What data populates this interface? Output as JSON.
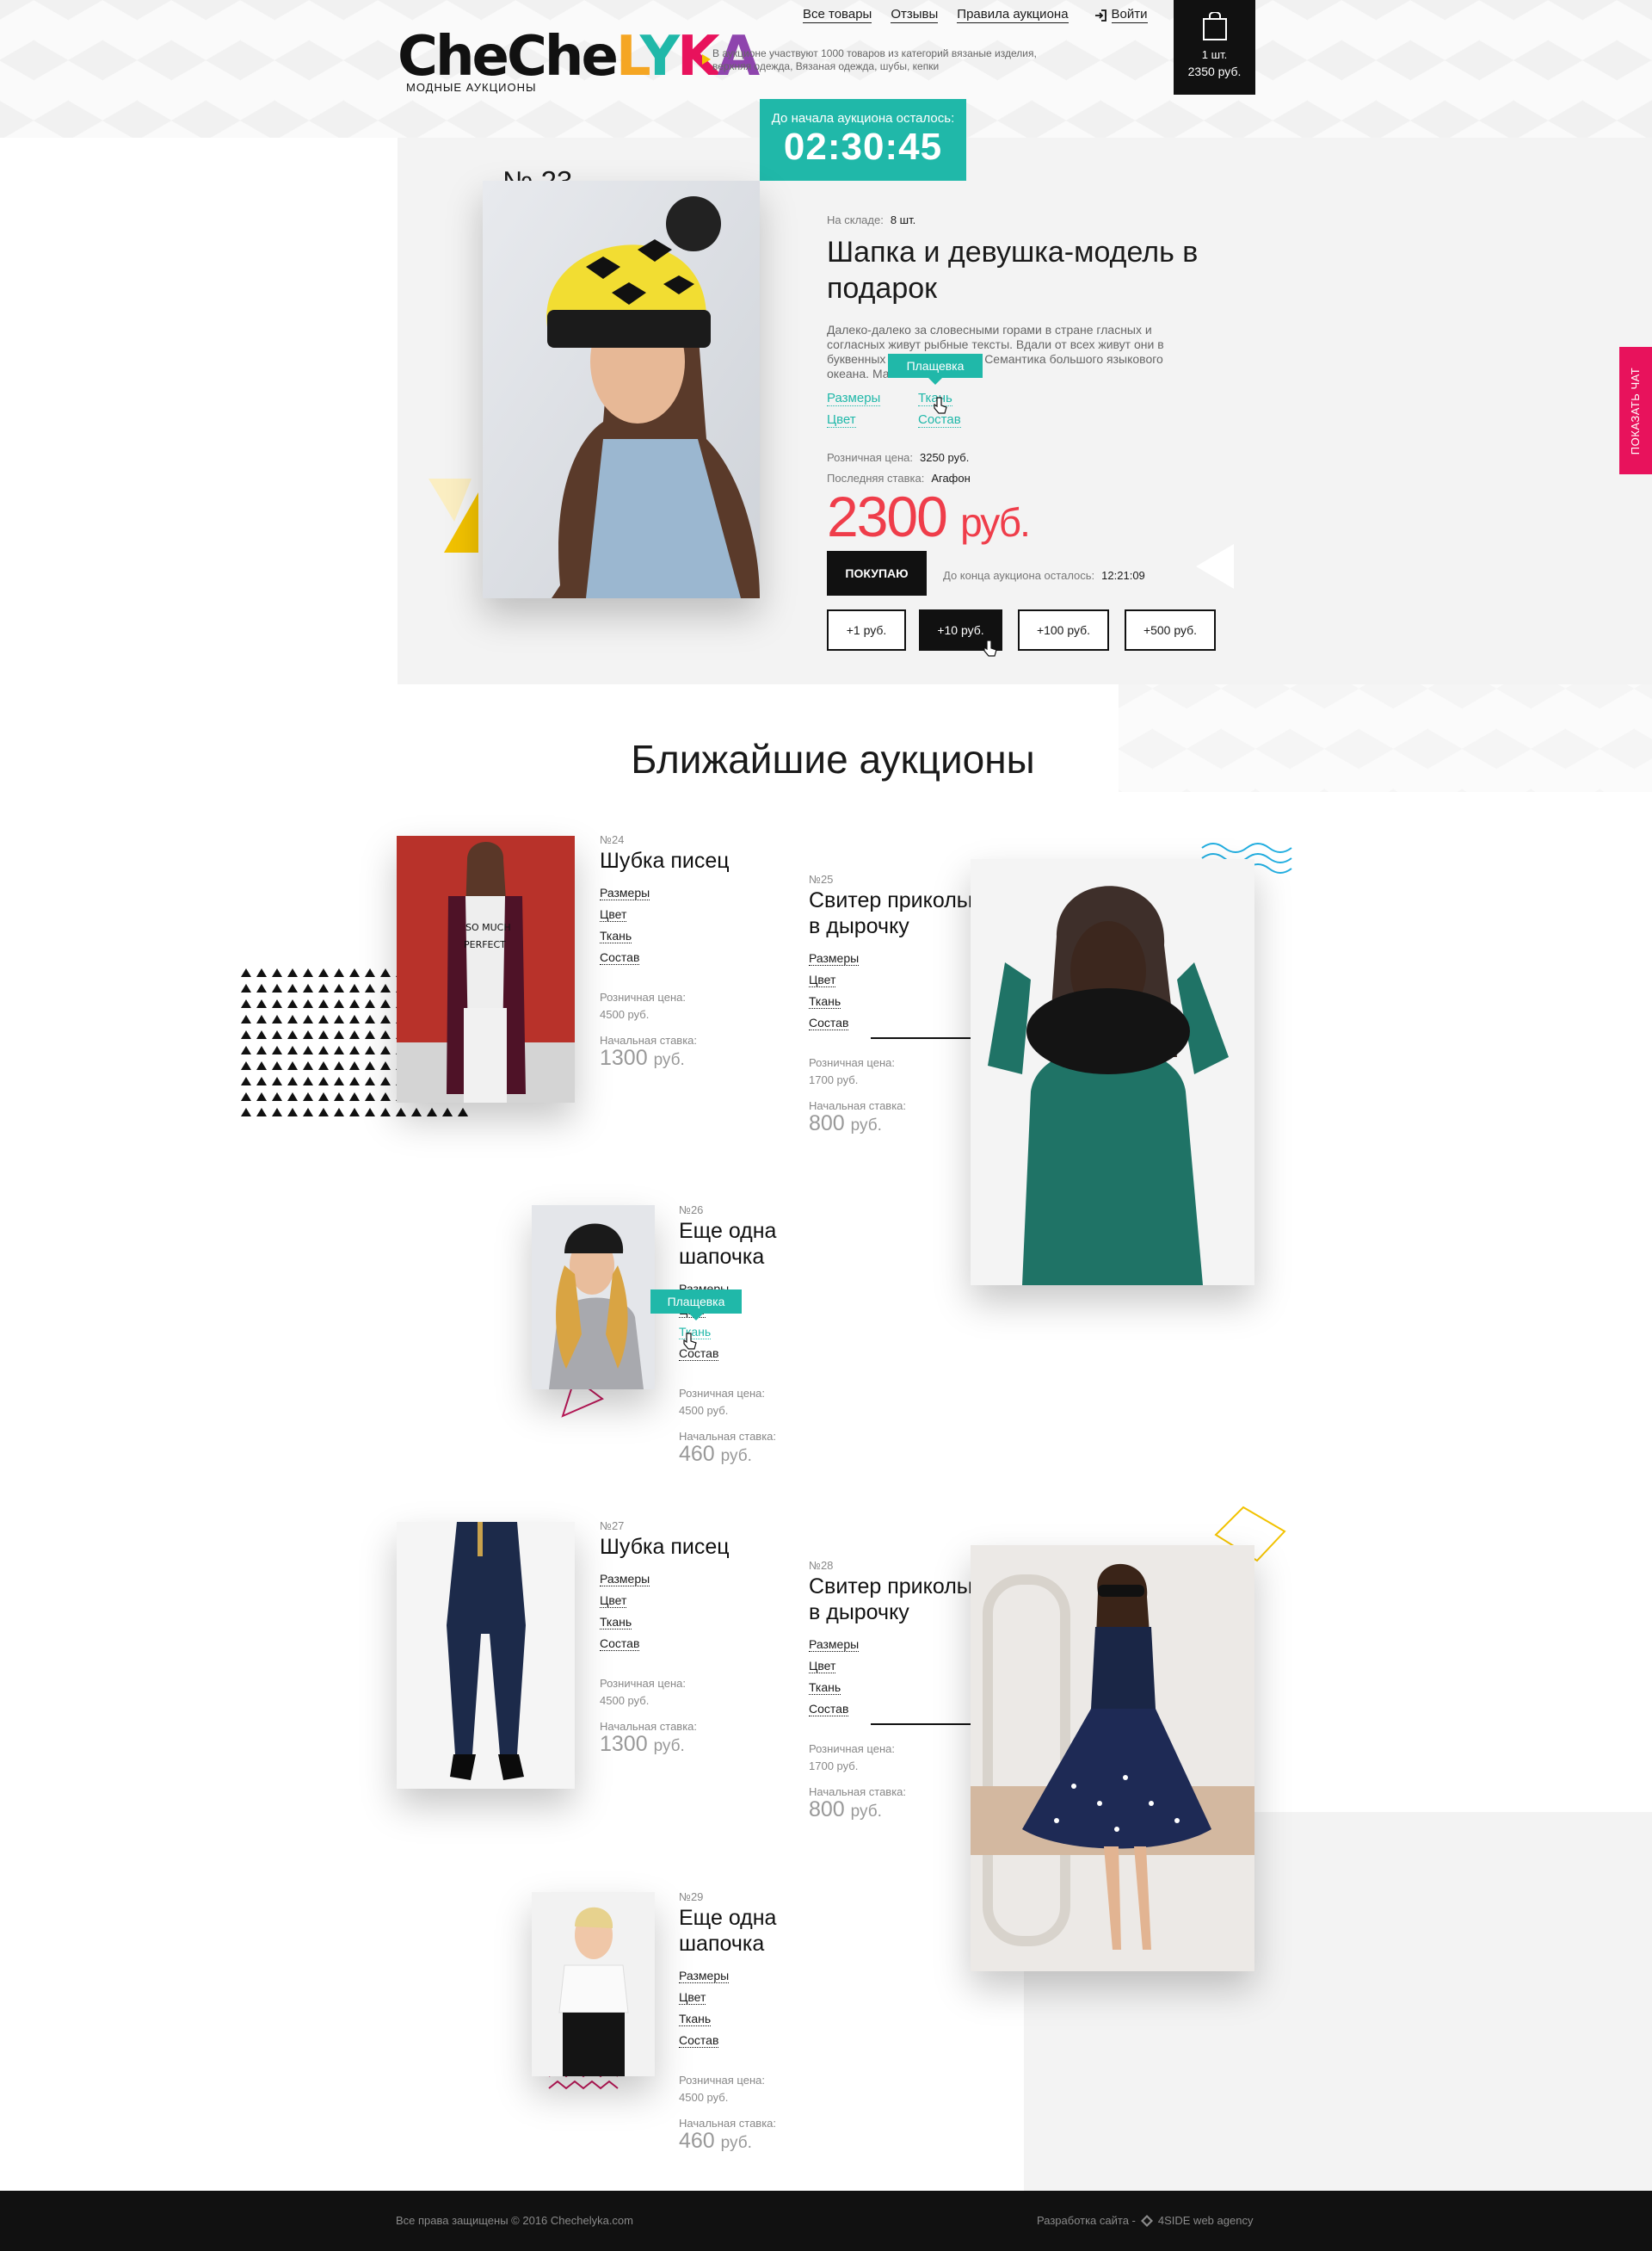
{
  "header": {
    "nav": [
      "Все товары",
      "Отзывы",
      "Правила аукциона"
    ],
    "login_label": "Войти",
    "cart": {
      "count": "1 шт.",
      "total": "2350 руб."
    },
    "logo": {
      "text": "CheCheLYKA",
      "subtitle": "МОДНЫЕ АУКЦИОНЫ"
    },
    "tagline": "В аукционе участвуют 1000 товаров из категорий вязаные изделия, верхняя одежда, Вязаная одежда, шубы, кепки"
  },
  "hero": {
    "timer_label": "До начала аукциона осталось:",
    "timer_value": "02:30:45",
    "lot_number": "№ 23",
    "stock_label": "На складе:",
    "stock_value": "8 шт.",
    "title": "Шапка и девушка-модель в подарок",
    "description": "Далеко-далеко за словесными горами в стране гласных и согласных живут рыбные тексты. Вдали от всех живут они в буквенных домах на берегу Семантика большого языкового океана. Маленький",
    "attrs": [
      "Размеры",
      "Ткань",
      "Цвет",
      "Состав"
    ],
    "tooltip": "Плащевка",
    "retail_label": "Розничная цена:",
    "retail_value": "3250 руб.",
    "last_bid_label": "Последняя ставка:",
    "last_bid_value": "Агафон",
    "price": "2300",
    "price_currency": "руб.",
    "buy_label": "ПОКУПАЮ",
    "end_label": "До конца аукциона осталось:",
    "end_value": "12:21:09",
    "bids": [
      "+1 руб.",
      "+10 руб.",
      "+100 руб.",
      "+500 руб."
    ]
  },
  "section_title": "Ближайшие аукционы",
  "common": {
    "links": [
      "Размеры",
      "Цвет",
      "Ткань",
      "Состав"
    ],
    "retail_label": "Розничная цена:",
    "start_label": "Начальная ставка:",
    "currency": "руб.",
    "tooltip": "Плащевка"
  },
  "lots": [
    {
      "no": "№24",
      "name": "Шубка писец",
      "retail": "4500 руб.",
      "start": "1300"
    },
    {
      "no": "№25",
      "name": "Свитер прикольный в дырочку",
      "retail": "1700 руб.",
      "start": "800"
    },
    {
      "no": "№26",
      "name": "Еще одна шапочка",
      "retail": "4500 руб.",
      "start": "460"
    },
    {
      "no": "№27",
      "name": "Шубка писец",
      "retail": "4500 руб.",
      "start": "1300"
    },
    {
      "no": "№28",
      "name": "Свитер прикольный в дырочку",
      "retail": "1700 руб.",
      "start": "800"
    },
    {
      "no": "№29",
      "name": "Еще одна шапочка",
      "retail": "4500 руб.",
      "start": "460"
    }
  ],
  "footer": {
    "copyright": "Все права защищены © 2016 Chechelyka.com",
    "dev_label": "Разработка сайта -",
    "dev_name": "4SIDE web agency"
  },
  "chat_label": "ПОКАЗАТЬ ЧАТ",
  "colors": {
    "accent": "#20b8a9",
    "price": "#ef3d4a",
    "chat": "#e8125c",
    "dark": "#111111"
  }
}
